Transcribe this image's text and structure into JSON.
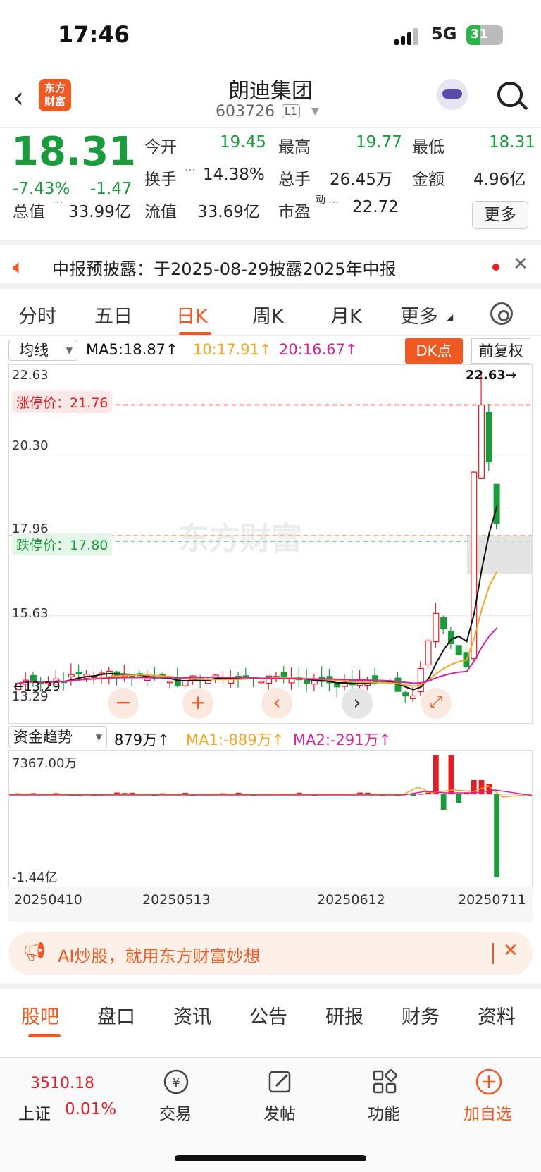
{
  "status": {
    "time": "17:46",
    "network": "5G",
    "battery": "31"
  },
  "header": {
    "title": "朗迪集团",
    "code": "603726",
    "level": "L1",
    "logo_line1": "东方",
    "logo_line2": "财富"
  },
  "quote": {
    "price": "18.31",
    "pct": "-7.43%",
    "chg": "-1.47",
    "open_label": "今开",
    "open": "19.45",
    "high_label": "最高",
    "high": "19.77",
    "low_label": "最低",
    "low": "18.31",
    "turnover_label": "换手",
    "turnover": "14.38%",
    "vol_label": "总手",
    "vol": "26.45万",
    "amt_label": "金额",
    "amt": "4.96亿",
    "mcap_label": "总值",
    "mcap": "33.99亿",
    "float_label": "流值",
    "float": "33.69亿",
    "pe_label": "市盈",
    "pe_sup": "动",
    "pe": "22.72",
    "more": "更多"
  },
  "notice": {
    "text": "中报预披露：于2025-08-29披露2025年中报"
  },
  "tabs": [
    "分时",
    "五日",
    "日K",
    "周K",
    "月K",
    "更多"
  ],
  "ma_row": {
    "select": "均线",
    "ma5": "MA5:18.87↑",
    "ma10": "10:17.91↑",
    "ma20": "20:16.67↑",
    "dk": "DK点",
    "fq": "前复权"
  },
  "chart": {
    "y_labels": [
      "22.63",
      "20.30",
      "17.96",
      "15.63",
      "13.29"
    ],
    "limit_up": "涨停价：21.76",
    "limit_down": "跌停价：17.80",
    "high_mark": "22.63→",
    "low_mark": "←13.29",
    "watermark": "东方财富"
  },
  "fund": {
    "select": "资金趋势",
    "value": "879万↑",
    "ma1": "MA1:-889万↑",
    "ma2": "MA2:-291万↑",
    "ytop": "7367.00万",
    "ybot": "-1.44亿"
  },
  "dates": [
    "20250410",
    "20250513",
    "20250612",
    "20250711"
  ],
  "ai": {
    "text": "AI炒股，就用东方财富妙想"
  },
  "subtabs": [
    "股吧",
    "盘口",
    "资讯",
    "公告",
    "研报",
    "财务",
    "资料"
  ],
  "bottom": {
    "index_value": "3510.18",
    "index_name": "上证",
    "index_pct": "0.01%",
    "items": [
      "交易",
      "发帖",
      "功能",
      "加自选"
    ]
  },
  "colors": {
    "up": "#e51c23",
    "down": "#1a9b3c",
    "accent": "#f05a22"
  }
}
